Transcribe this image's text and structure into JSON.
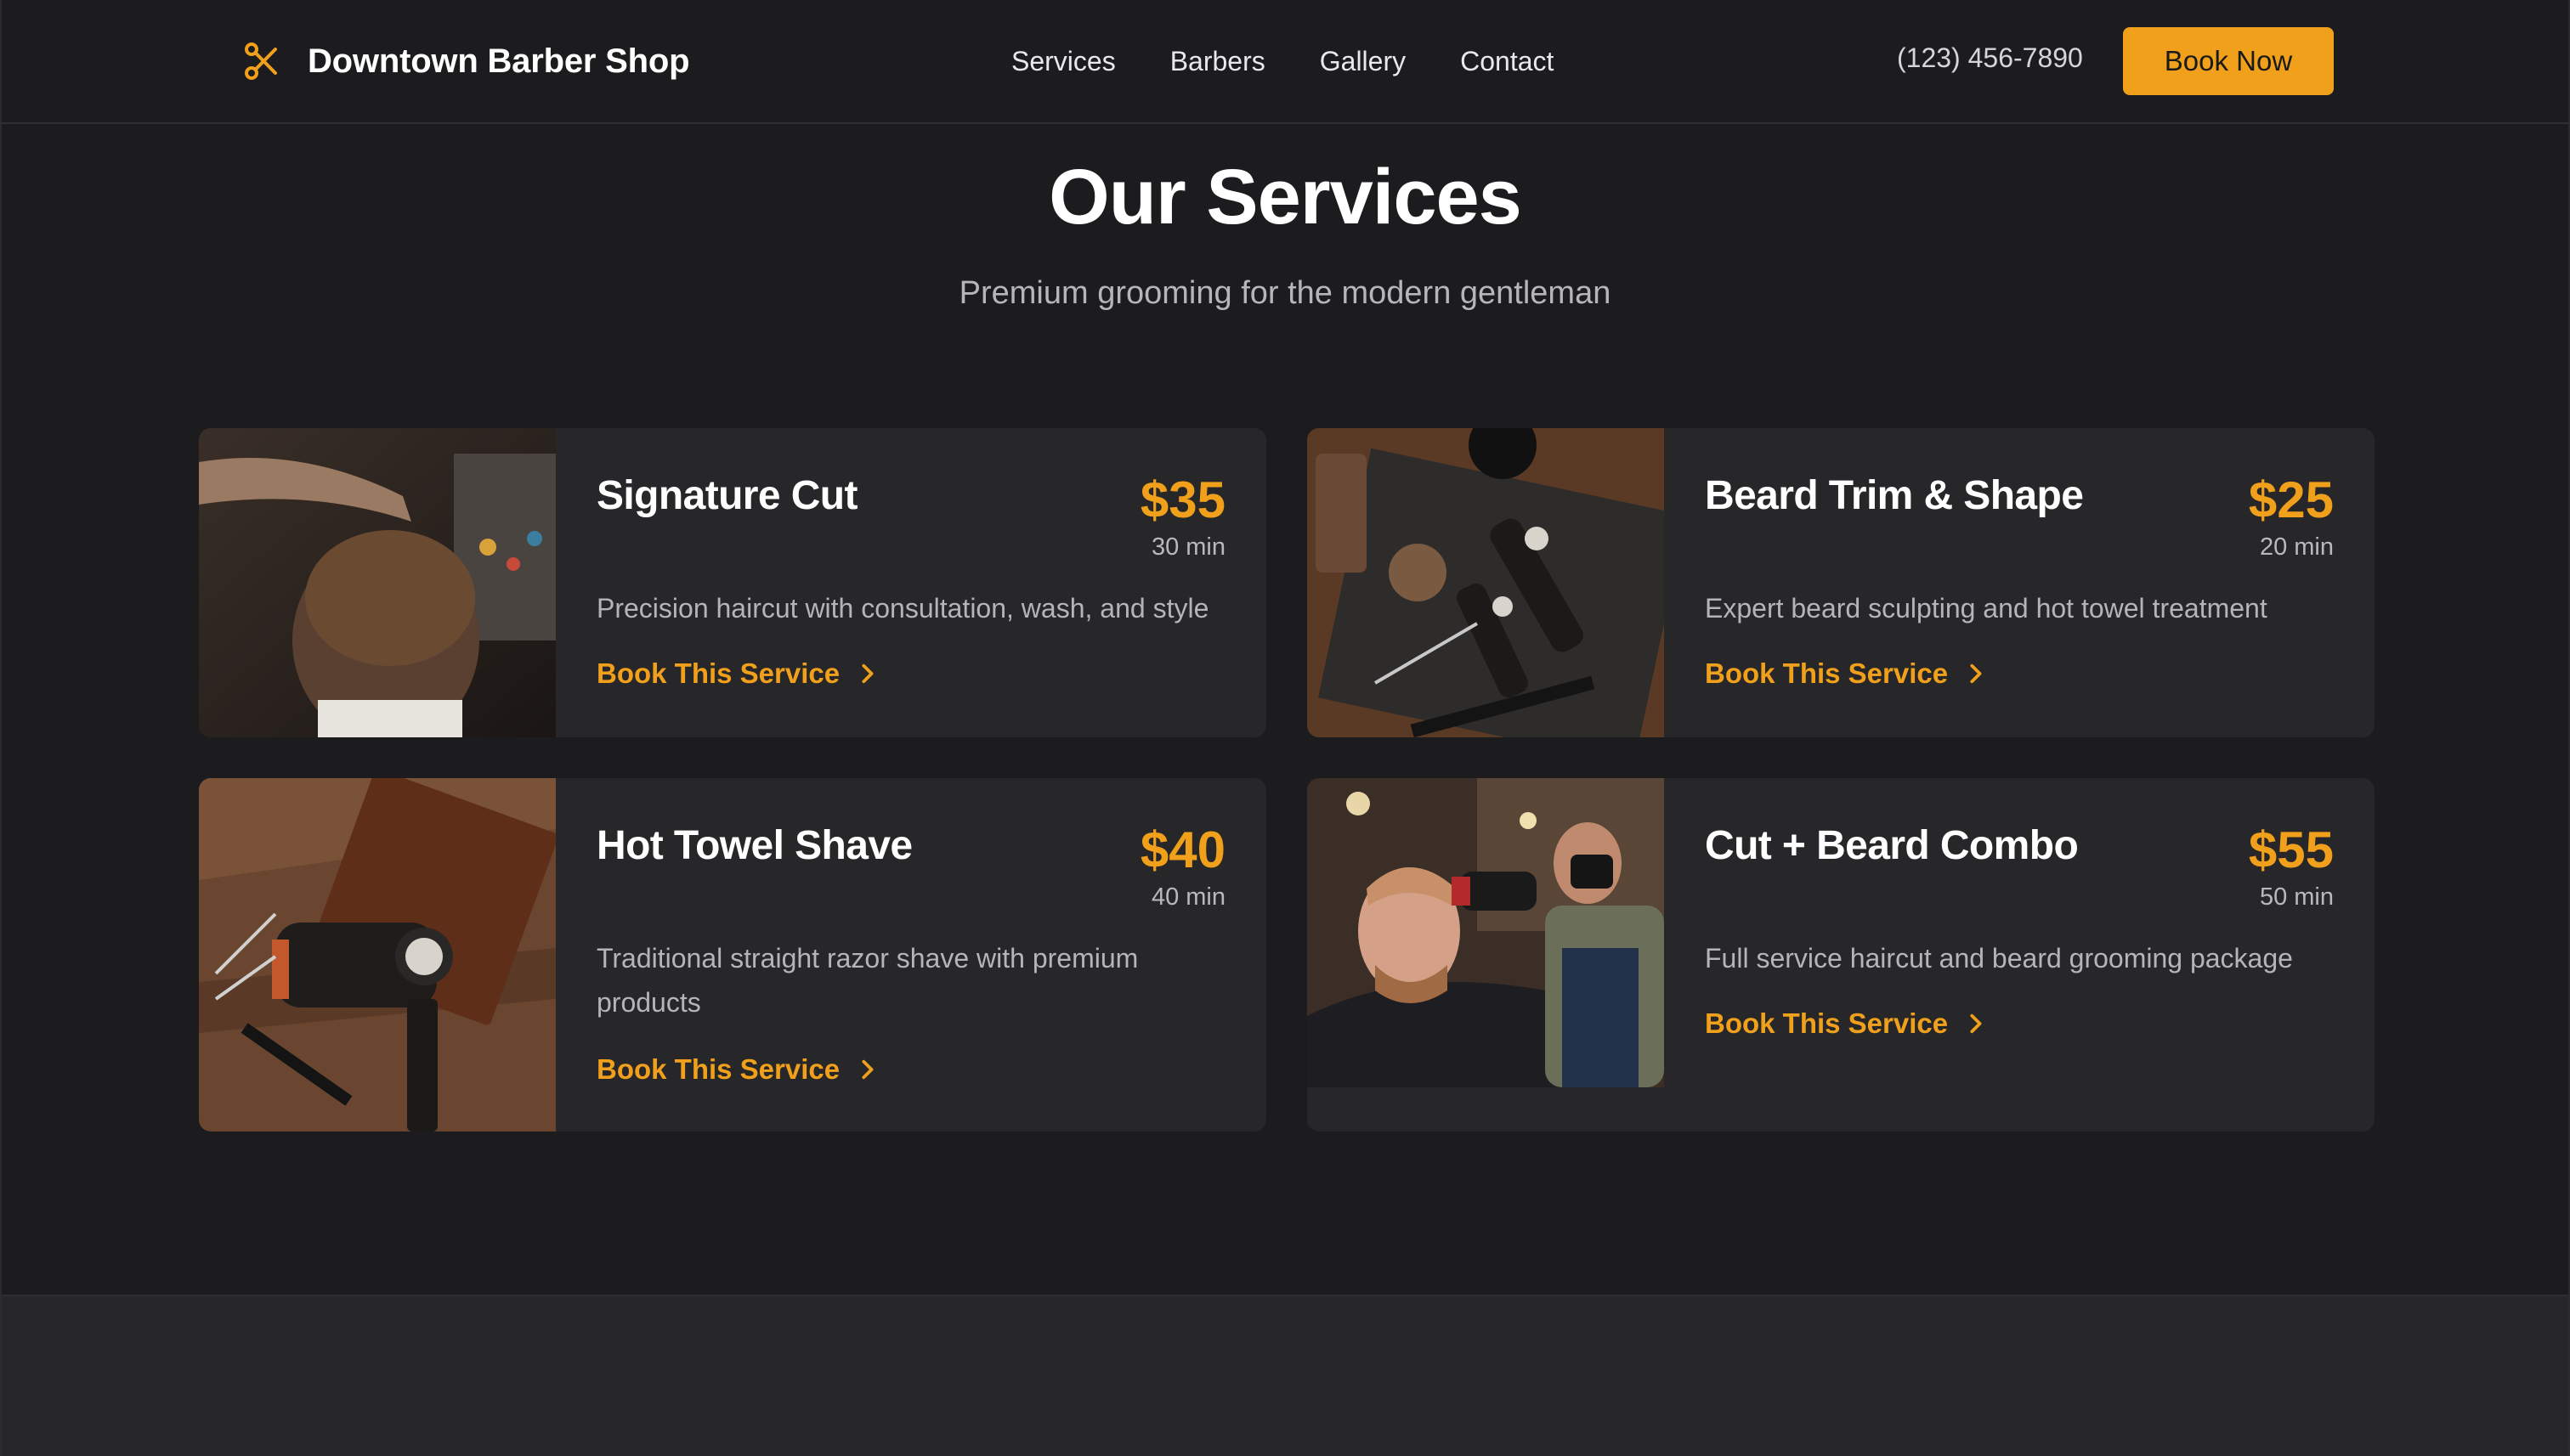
{
  "header": {
    "brand": "Downtown Barber Shop",
    "nav": [
      "Services",
      "Barbers",
      "Gallery",
      "Contact"
    ],
    "phone": "(123) 456-7890",
    "cta": "Book Now"
  },
  "hero": {
    "title": "Our Services",
    "subtitle": "Premium grooming for the modern gentleman"
  },
  "services": [
    {
      "name": "Signature Cut",
      "price": "$35",
      "duration": "30 min",
      "description": "Precision haircut with consultation, wash, and style",
      "link": "Book This Service"
    },
    {
      "name": "Beard Trim & Shape",
      "price": "$25",
      "duration": "20 min",
      "description": "Expert beard sculpting and hot towel treatment",
      "link": "Book This Service"
    },
    {
      "name": "Hot Towel Shave",
      "price": "$40",
      "duration": "40 min",
      "description": "Traditional straight razor shave with premium products",
      "link": "Book This Service"
    },
    {
      "name": "Cut + Beard Combo",
      "price": "$55",
      "duration": "50 min",
      "description": "Full service haircut and beard grooming package",
      "link": "Book This Service"
    }
  ],
  "icons": {
    "brand": "scissors-icon",
    "link_arrow": "chevron-right-icon"
  },
  "colors": {
    "accent": "#f0a01b",
    "background": "#1c1c1f",
    "card": "#27272a"
  }
}
